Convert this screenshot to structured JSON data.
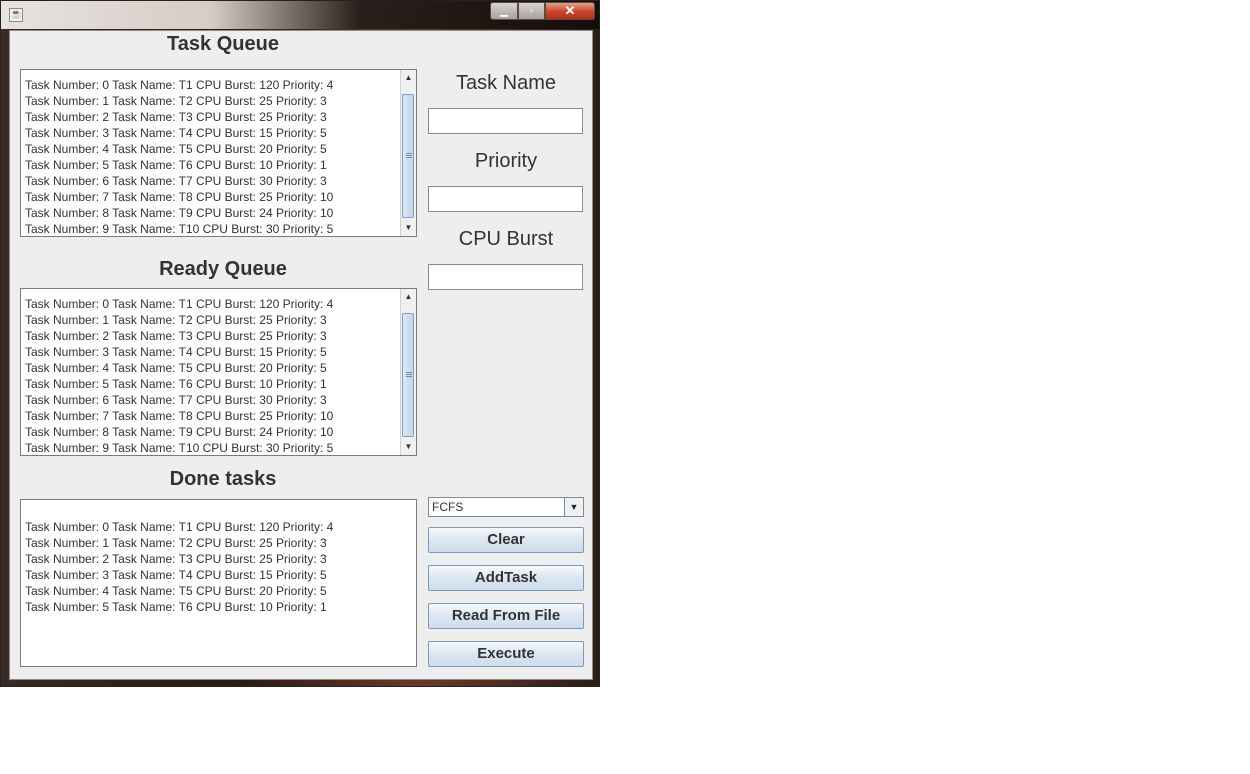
{
  "window": {
    "title": ""
  },
  "task_queue": {
    "title": "Task Queue",
    "items": [
      "Task Number: 0 Task Name: T1 CPU Burst: 120 Priority: 4",
      "Task Number: 1 Task Name: T2 CPU Burst: 25 Priority: 3",
      "Task Number: 2 Task Name: T3 CPU Burst: 25 Priority: 3",
      "Task Number: 3 Task Name: T4 CPU Burst: 15 Priority: 5",
      "Task Number: 4 Task Name: T5 CPU Burst: 20 Priority: 5",
      "Task Number: 5 Task Name: T6 CPU Burst: 10 Priority: 1",
      "Task Number: 6 Task Name: T7 CPU Burst: 30 Priority: 3",
      "Task Number: 7 Task Name: T8 CPU Burst: 25 Priority: 10",
      "Task Number: 8 Task Name: T9 CPU Burst: 24 Priority: 10",
      "Task Number: 9 Task Name: T10 CPU Burst: 30 Priority: 5"
    ]
  },
  "ready_queue": {
    "title": "Ready Queue",
    "items": [
      "Task Number: 0 Task Name: T1 CPU Burst: 120 Priority: 4",
      "Task Number: 1 Task Name: T2 CPU Burst: 25 Priority: 3",
      "Task Number: 2 Task Name: T3 CPU Burst: 25 Priority: 3",
      "Task Number: 3 Task Name: T4 CPU Burst: 15 Priority: 5",
      "Task Number: 4 Task Name: T5 CPU Burst: 20 Priority: 5",
      "Task Number: 5 Task Name: T6 CPU Burst: 10 Priority: 1",
      "Task Number: 6 Task Name: T7 CPU Burst: 30 Priority: 3",
      "Task Number: 7 Task Name: T8 CPU Burst: 25 Priority: 10",
      "Task Number: 8 Task Name: T9 CPU Burst: 24 Priority: 10",
      "Task Number: 9 Task Name: T10 CPU Burst: 30 Priority: 5"
    ]
  },
  "done_tasks": {
    "title": "Done tasks",
    "items": [
      "Task Number: 0 Task Name: T1 CPU Burst: 120 Priority: 4",
      "Task Number: 1 Task Name: T2 CPU Burst: 25 Priority: 3",
      "Task Number: 2 Task Name: T3 CPU Burst: 25 Priority: 3",
      "Task Number: 3 Task Name: T4 CPU Burst: 15 Priority: 5",
      "Task Number: 4 Task Name: T5 CPU Burst: 20 Priority: 5",
      "Task Number: 5 Task Name: T6 CPU Burst: 10 Priority: 1"
    ]
  },
  "form": {
    "task_name_label": "Task Name",
    "task_name_value": "",
    "priority_label": "Priority",
    "priority_value": "",
    "cpu_burst_label": "CPU Burst",
    "cpu_burst_value": ""
  },
  "algorithm": {
    "selected": "FCFS"
  },
  "buttons": {
    "clear": "Clear",
    "add_task": "AddTask",
    "read_from_file": "Read From File",
    "execute": "Execute"
  },
  "icons": {
    "app": "java-icon",
    "minimize": "minimize-icon",
    "maximize": "maximize-icon",
    "close": "close-icon",
    "scroll_up": "arrow-up-icon",
    "scroll_down": "arrow-down-icon",
    "dropdown": "chevron-down-icon"
  },
  "colors": {
    "button_top": "#f6f9fc",
    "button_bottom": "#cfdceb",
    "close_button": "#c7432a",
    "panel_bg": "#eeeeee"
  }
}
